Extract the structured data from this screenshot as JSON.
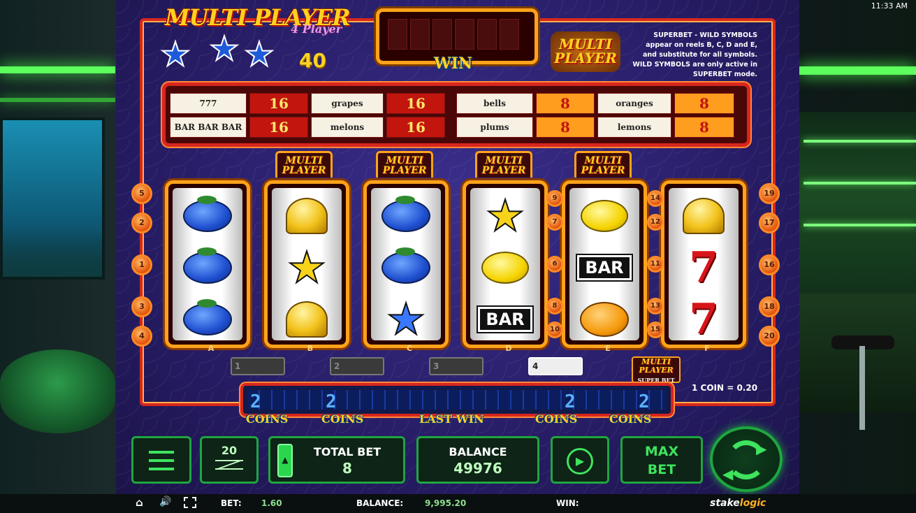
{
  "clock": "11:33 AM",
  "game": {
    "title": "MULTI PLAYER",
    "title_sub": "4 Player",
    "stars_count": "40",
    "win_label": "WIN",
    "multi_player_logo": [
      "MULTI",
      "PLAYER"
    ],
    "superbet_info": "SUPERBET - WILD SYMBOLS appear on reels B, C, D and E, and substitute for all symbols. WILD SYMBOLS are only active in SUPERBET mode."
  },
  "paytable": {
    "row1": [
      {
        "symbol": "777",
        "value": "16"
      },
      {
        "symbol": "grapes",
        "value": "16"
      },
      {
        "symbol": "bells",
        "value": "8"
      },
      {
        "symbol": "oranges",
        "value": "8"
      }
    ],
    "row2": [
      {
        "symbol": "BAR BAR BAR",
        "value": "16"
      },
      {
        "symbol": "melons",
        "value": "16"
      },
      {
        "symbol": "plums",
        "value": "8"
      },
      {
        "symbol": "lemons",
        "value": "8"
      }
    ]
  },
  "reel_badge_label": [
    "MULTI",
    "PLAYER"
  ],
  "reels": [
    {
      "letter": "A",
      "symbols": [
        "plum",
        "plum",
        "plum"
      ]
    },
    {
      "letter": "B",
      "symbols": [
        "bell",
        "star-gold",
        "bell"
      ]
    },
    {
      "letter": "C",
      "symbols": [
        "plum",
        "plum",
        "star-blue"
      ]
    },
    {
      "letter": "D",
      "symbols": [
        "star-gold",
        "lemon",
        "bar"
      ]
    },
    {
      "letter": "E",
      "symbols": [
        "lemon",
        "bar",
        "orange"
      ]
    },
    {
      "letter": "F",
      "symbols": [
        "bell",
        "seven",
        "seven"
      ]
    }
  ],
  "bar_text": "BAR",
  "seven_text": "7",
  "line_numbers": {
    "left": [
      "5",
      "2",
      "1",
      "3",
      "4"
    ],
    "mid_d": [
      "9",
      "7",
      "6",
      "8",
      "10"
    ],
    "mid_e": [
      "14",
      "12",
      "11",
      "13",
      "15"
    ],
    "right": [
      "19",
      "17",
      "16",
      "18",
      "20"
    ]
  },
  "bet_slots": [
    "1",
    "2",
    "3",
    "4"
  ],
  "active_bet_slot": "4",
  "superbet_badge": {
    "line1": "MULTI",
    "line2": "PLAYER",
    "sub": "SUPER BET"
  },
  "coin_value": "1 COIN = 0.20",
  "coin_strip": {
    "digits": [
      "2",
      "2",
      "2",
      "2"
    ],
    "labels": [
      "COINS",
      "COINS",
      "LAST WIN",
      "COINS",
      "COINS"
    ]
  },
  "controls": {
    "lines": "20",
    "total_bet_label": "TOTAL BET",
    "total_bet_value": "8",
    "balance_label": "BALANCE",
    "balance_value": "49976",
    "max_bet_label": "MAX BET"
  },
  "statusbar": {
    "bet_label": "BET:",
    "bet_value": "1.60",
    "balance_label": "BALANCE:",
    "balance_value": "9,995.20",
    "win_label": "WIN:",
    "brand_a": "stake",
    "brand_b": "logic"
  },
  "colors": {
    "accent_green": "#1ea640",
    "pipe_red": "#d8261e",
    "gold": "#ffd21f"
  }
}
